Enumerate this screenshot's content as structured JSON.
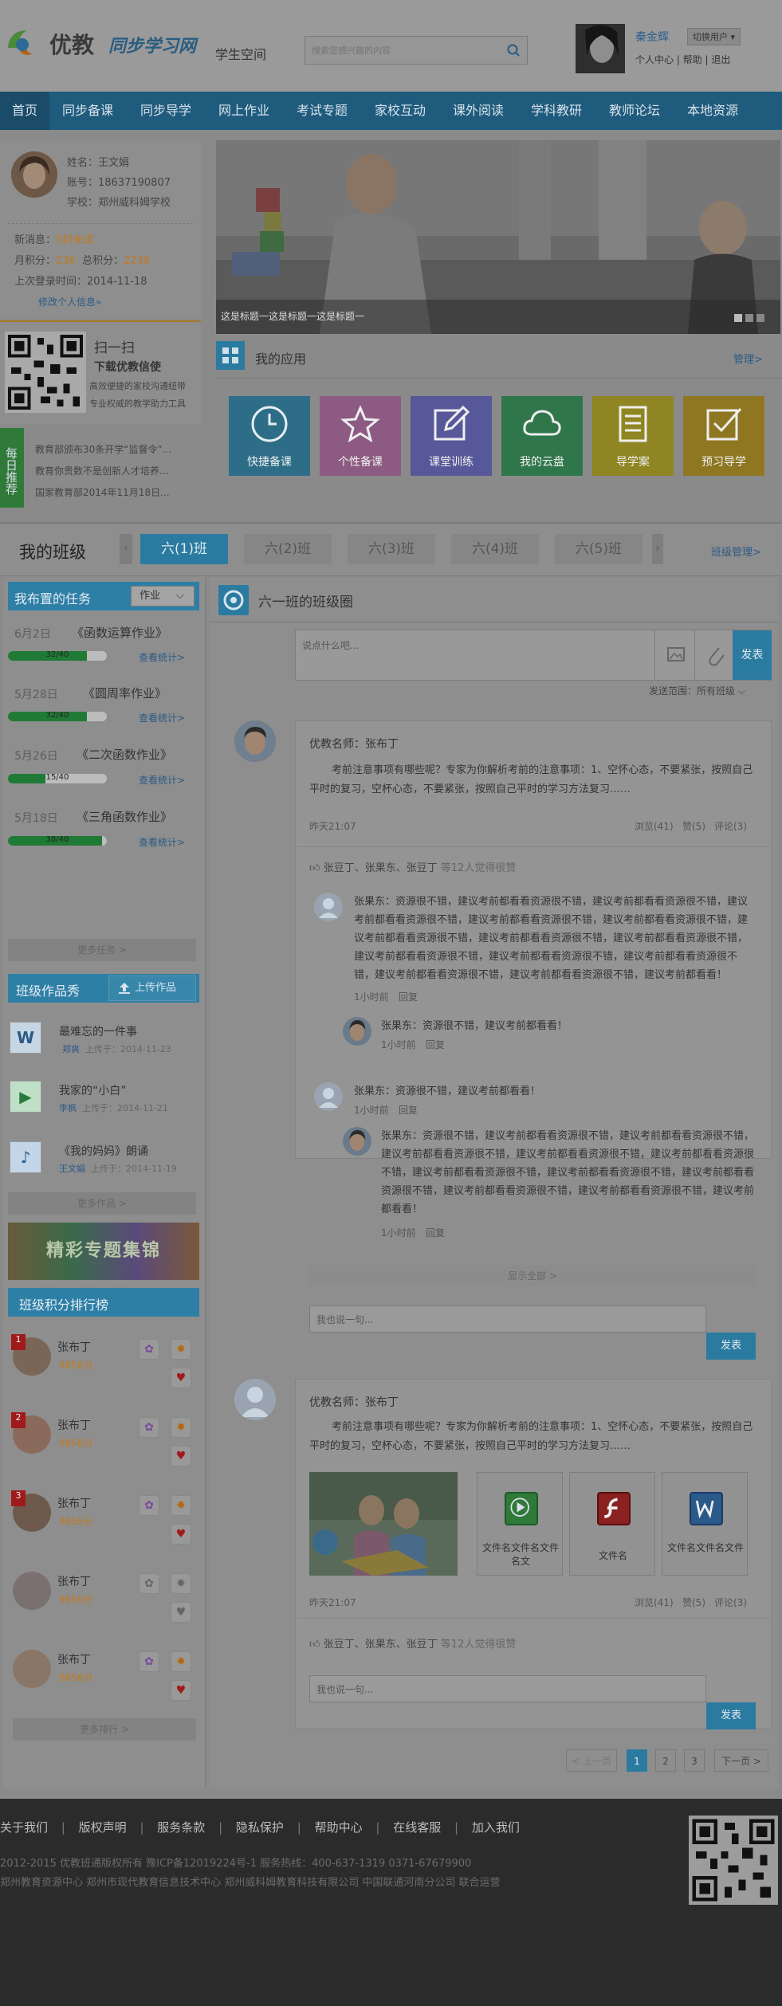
{
  "header": {
    "brand": "优教",
    "brand_sub": "同步学习网",
    "space": "学生空间",
    "search_placeholder": "搜索您感兴趣的内容",
    "user_name": "秦金辉",
    "switch_user": "切换用户",
    "links": [
      "个人中心",
      "帮助",
      "退出"
    ]
  },
  "nav": {
    "items": [
      "首页",
      "同步备课",
      "同步导学",
      "网上作业",
      "考试专题",
      "家校互动",
      "课外阅读",
      "学科教研",
      "教师论坛",
      "本地资源"
    ]
  },
  "profile": {
    "name_label": "姓名：",
    "name": "王文娟",
    "account_label": "账号：",
    "account": "18637190807",
    "school_label": "学校：",
    "school": "郑州威科姆学校",
    "new_msg_label": "新消息：",
    "new_msg": "5封未读",
    "month_points_label": "月积分：",
    "month_points": "236",
    "total_points_label": "总积分：",
    "total_points": "2236",
    "last_login_label": "上次登录时间：",
    "last_login": "2014-11-18",
    "edit_link": "修改个人信息»"
  },
  "qr_promo": {
    "title": "扫一扫",
    "subtitle": "下载优教信使",
    "desc1": "高效便捷的家校沟通纽带",
    "desc2": "专业权威的教学助力工具"
  },
  "daily": {
    "tag": "每日推荐",
    "items": [
      "教育部颁布30条开学“监督令”...",
      "教育你贵数不是创新人才培养...",
      "国家教育部2014年11月18日..."
    ]
  },
  "banner": {
    "caption": "这是标题一这是标题一这是标题一"
  },
  "apps": {
    "title": "我的应用",
    "manage": "管理>",
    "items": [
      {
        "label": "快捷备课",
        "color": "#2d86a7",
        "icon": "clock-icon"
      },
      {
        "label": "个性备课",
        "color": "#a65b93",
        "icon": "star-icon"
      },
      {
        "label": "课堂训练",
        "color": "#5d5ab3",
        "icon": "edit-icon"
      },
      {
        "label": "我的云盘",
        "color": "#2f8c4e",
        "icon": "cloud-icon"
      },
      {
        "label": "导学案",
        "color": "#a79a20",
        "icon": "document-icon"
      },
      {
        "label": "预习导学",
        "color": "#a8881f",
        "icon": "check-icon"
      }
    ]
  },
  "class_bar": {
    "title": "我的班级",
    "tabs": [
      "六(1)班",
      "六(2)班",
      "六(3)班",
      "六(4)班",
      "六(5)班"
    ],
    "manage": "班级管理>"
  },
  "tasks": {
    "title": "我布置的任务",
    "filter": "作业",
    "stat_label": "查看统计>",
    "items": [
      {
        "date": "6月2日",
        "name": "《函数运算作业》",
        "progress": "32/40",
        "ratio": 0.8
      },
      {
        "date": "5月28日",
        "name": "《圆周率作业》",
        "progress": "32/40",
        "ratio": 0.8
      },
      {
        "date": "5月26日",
        "name": "《二次函数作业》",
        "progress": "15/40",
        "ratio": 0.375
      },
      {
        "date": "5月18日",
        "name": "《三角函数作业》",
        "progress": "38/40",
        "ratio": 0.95
      }
    ],
    "more": "更多任务 >"
  },
  "works": {
    "title": "班级作品秀",
    "upload": "上传作品",
    "uploaded_label": "上传于：",
    "items": [
      {
        "title": "最难忘的一件事",
        "author": "郑爽",
        "date": "2014-11-23",
        "type": "W"
      },
      {
        "title": "我家的“小白”",
        "author": "李枫",
        "date": "2014-11-21",
        "type": "▶"
      },
      {
        "title": "《我的妈妈》朗诵",
        "author": "王文娟",
        "date": "2014-11-19",
        "type": "♪"
      }
    ],
    "more": "更多作品 >"
  },
  "special_banner": "精彩专题集锦",
  "ranking": {
    "title": "班级积分排行榜",
    "unit": "分",
    "items": [
      {
        "rank": "1",
        "name": "张布丁",
        "score": "9856"
      },
      {
        "rank": "2",
        "name": "张布丁",
        "score": "9856"
      },
      {
        "rank": "3",
        "name": "张布丁",
        "score": "9856"
      },
      {
        "rank": "",
        "name": "张布丁",
        "score": "9856"
      },
      {
        "rank": "",
        "name": "张布丁",
        "score": "9856"
      }
    ],
    "more": "更多排行 >"
  },
  "feed": {
    "title": "六一班的班级圈",
    "composer_placeholder": "说点什么吧...",
    "publish": "发表",
    "scope": "发送范围：所有班级",
    "posts": [
      {
        "author": "优教名师：张布丁",
        "text": "考前注意事项有哪些呢？专家为你解析考前的注意事项：1、空怀心态，不要紧张，按照自己平时的复习，空杯心态，不要紧张，按照自己平时的学习方法复习……",
        "time": "昨天21:07",
        "views": "浏览(41)",
        "likes": "赞(5)",
        "comments": "评论(3)",
        "liked_by": "张豆丁、张果东、张豆丁",
        "liked_count": "等12人觉得很赞",
        "comment_placeholder": "我也说一句...",
        "show_all": "显示全部 >",
        "publish": "发表"
      },
      {
        "author": "优教名师：张布丁",
        "text": "考前注意事项有哪些呢？专家为你解析考前的注意事项：1、空怀心态，不要紧张，按照自己平时的复习，空杯心态，不要紧张，按照自己平时的学习方法复习……",
        "time": "昨天21:07",
        "views": "浏览(41)",
        "likes": "赞(5)",
        "comments": "评论(3)",
        "liked_by": "张豆丁、张果东、张豆丁",
        "liked_count": "等12人觉得很赞",
        "comment_placeholder": "我也说一句...",
        "publish": "发表",
        "attachments": [
          {
            "name": "文件名文件名文件名文",
            "type": "video"
          },
          {
            "name": "文件名",
            "type": "flash"
          },
          {
            "name": "文件名文件名文件",
            "type": "word"
          }
        ]
      }
    ],
    "comments": [
      {
        "author": "张果东",
        "text": "资源很不错，建议考前都看看资源很不错，建议考前都看看资源很不错，建议考前都看看资源很不错，建议考前都看看资源很不错，建议考前都看看资源很不错，建议考前都看看资源很不错，建议考前都看看资源很不错，建议考前都看看资源很不错，建议考前都看看资源很不错，建议考前都看看资源很不错，建议考前都看看资源很不错，建议考前都看看资源很不错，建议考前都看看资源很不错，建议考前都看看！",
        "time": "1小时前",
        "reply": "回复"
      },
      {
        "author": "张果东",
        "text": "资源很不错，建议考前都看看！",
        "time": "1小时前",
        "reply": "回复"
      },
      {
        "author": "张果东",
        "text": "资源很不错，建议考前都看看！",
        "time": "1小时前",
        "reply": "回复"
      },
      {
        "author": "张果东",
        "text": "资源很不错，建议考前都看看资源很不错，建议考前都看看资源很不错，建议考前都看看资源很不错，建议考前都看看资源很不错，建议考前都看看资源很不错，建议考前都看看资源很不错，建议考前都看看资源很不错，建议考前都看看资源很不错，建议考前都看看资源很不错，建议考前都看看资源很不错，建议考前都看看！",
        "time": "1小时前",
        "reply": "回复"
      }
    ],
    "comment_sep": "："
  },
  "pagination": {
    "prev": "< 上一页",
    "pages": [
      "1",
      "2",
      "3"
    ],
    "next": "下一页 >"
  },
  "footer": {
    "links": [
      "关于我们",
      "版权声明",
      "服务条款",
      "隐私保护",
      "帮助中心",
      "在线客服",
      "加入我们"
    ],
    "sep": "|",
    "copyright": "2012-2015 优教班通版权所有 豫ICP备12019224号-1    服务热线：400-637-1319    0371-67679900",
    "partners": "郑州教育资源中心    郑州市现代教育信息技术中心  郑州威科姆教育科技有限公司 中国联通河南分公司  联合运营"
  }
}
